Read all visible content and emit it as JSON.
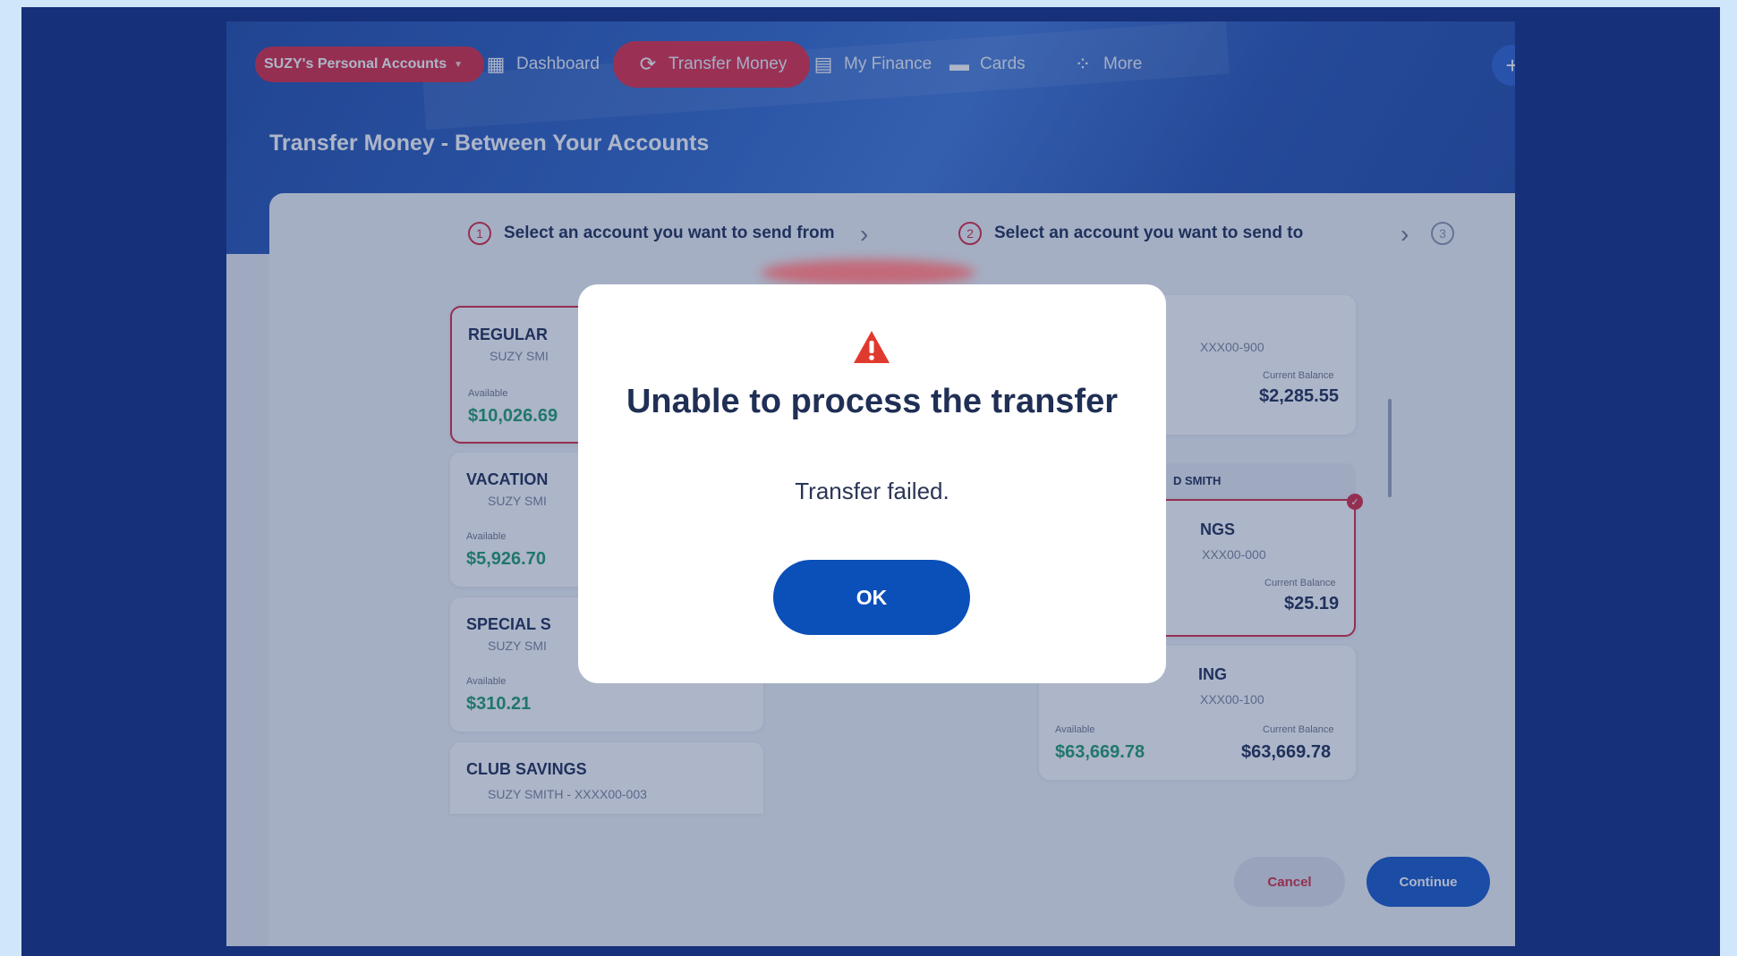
{
  "nav": {
    "account_switcher": "SUZY's Personal Accounts",
    "items": [
      {
        "label": "Dashboard",
        "icon": "dashboard-icon"
      },
      {
        "label": "Transfer Money",
        "icon": "transfer-icon"
      },
      {
        "label": "My Finance",
        "icon": "finance-icon"
      },
      {
        "label": "Cards",
        "icon": "card-icon"
      },
      {
        "label": "More",
        "icon": "more-grid-icon"
      }
    ],
    "plus": "+"
  },
  "page_title": "Transfer Money - Between Your Accounts",
  "steps": [
    {
      "num": "1",
      "label": "Select an account you want to send from"
    },
    {
      "num": "2",
      "label": "Select an account you want to send to"
    },
    {
      "num": "3",
      "label": ""
    }
  ],
  "from_accounts": [
    {
      "name": "REGULAR",
      "sub": "SUZY SMI",
      "avail_label": "Available",
      "available": "$10,026.69"
    },
    {
      "name": "VACATION",
      "sub": "SUZY SMI",
      "avail_label": "Available",
      "available": "$5,926.70"
    },
    {
      "name": "SPECIAL S",
      "sub": "SUZY SMI",
      "avail_label": "Available",
      "available": "$310.21"
    },
    {
      "name": "CLUB SAVINGS",
      "sub": "SUZY SMITH - XXXX00-003"
    }
  ],
  "to_accounts": [
    {
      "sub": "XXX00-900",
      "bal_label": "Current Balance",
      "balance": "$2,285.55"
    },
    {
      "group": "D SMITH",
      "name": "NGS",
      "sub": "XXX00-000",
      "bal_label": "Current Balance",
      "balance": "$25.19"
    },
    {
      "name": "ING",
      "sub": "XXX00-100",
      "avail_label": "Available",
      "available": "$63,669.78",
      "bal_label": "Current Balance",
      "balance": "$63,669.78"
    }
  ],
  "buttons": {
    "cancel": "Cancel",
    "continue": "Continue"
  },
  "modal": {
    "icon": "warning-icon",
    "title": "Unable to process the transfer",
    "message": "Transfer failed.",
    "ok": "OK"
  },
  "colors": {
    "brand_red": "#d9283f",
    "brand_blue": "#0b4fb8",
    "frame_blue": "#16307a",
    "positive_green": "#1e9b69"
  }
}
